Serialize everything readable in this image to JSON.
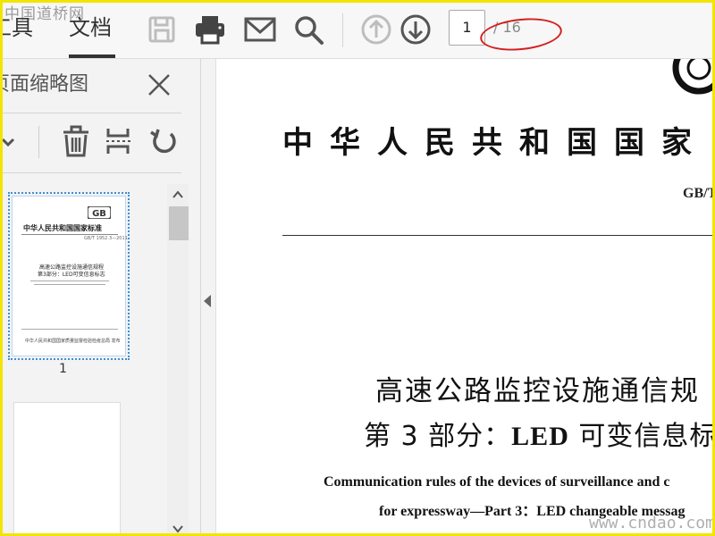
{
  "toolbar": {
    "tab_tools": "工具",
    "tab_document": "文档",
    "current_page": "1",
    "total_pages": "/ 16",
    "watermark": "中国道桥网"
  },
  "sidebar": {
    "title": "页面缩略图",
    "thumbnail_page_label": "1"
  },
  "thumbnail": {
    "header": "中华人民共和国国家标准",
    "code": "GB/T 1952.3—2011",
    "cn_title_1": "高速公路监控设施通信规程",
    "cn_title_2": "第3部分：LED可变信息标志",
    "publisher": "中华人民共和国国家质量监督检验检疫总局 发布"
  },
  "document": {
    "header_title": "中华人民共和国国家",
    "standard_code": "GB/T",
    "cn_title_line1": "高速公路监控设施通信规",
    "cn_title_line2_a": "第 3 部分：",
    "cn_title_line2_b": "LED",
    "cn_title_line2_c": " 可变信息标",
    "en_title_line1": "Communication rules of the devices of surveillance and c",
    "en_title_line2": "for expressway—Part 3：LED changeable messag",
    "watermark": "www.cndao.com"
  },
  "colors": {
    "accent_border": "#f2e500",
    "annotation_red": "#d41f1f",
    "selection_blue": "#3f8fd6"
  }
}
